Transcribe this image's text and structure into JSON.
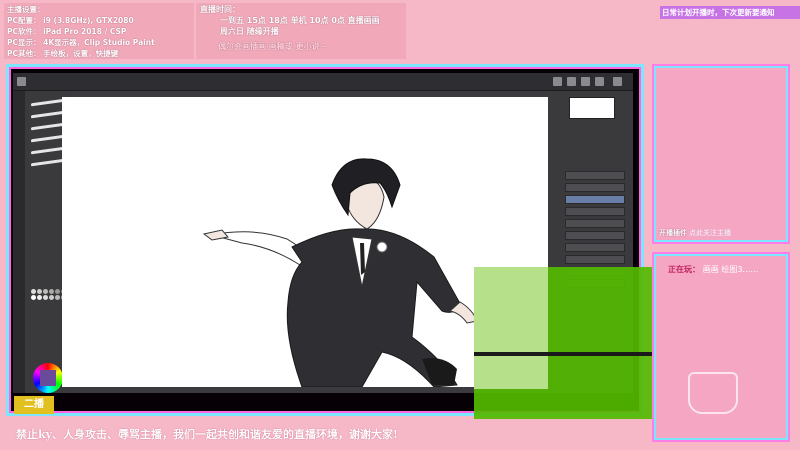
{
  "header": {
    "host_label": "主播设置：",
    "rows": [
      "PC配置：  i9 (3.8GHz), GTX2080",
      "PC软件：  iPad Pro 2018 / CSP",
      "PC显示：  4K显示器，Clip Studio Paint",
      "PC其他：  手绘板，设置，快捷键"
    ],
    "schedule_title": "直播时间：",
    "schedule_lines": [
      "一到五 15点 18点 单机 10点 0点 直播画画",
      "周六日 随缘开播",
      "偶尔会画插画 画稿或 更小说~"
    ]
  },
  "top_notice": "日常计划开播时，下次更新要通知",
  "side_panel": {
    "caption": "开播插件",
    "caption_value": "点此关注主播",
    "now_playing_label": "正在玩：",
    "now_playing_value": "画画 绘图3……"
  },
  "watermark": "二播",
  "bottom_notice": "禁止ky、人身攻击、辱骂主播，我们一起共创和谐友爱的直播环境，谢谢大家!",
  "colors": {
    "background": "#f6b8c6",
    "frame_cyan": "#7de6ff",
    "frame_magenta": "#ff66e0",
    "overlay_green": "#54ba00"
  }
}
